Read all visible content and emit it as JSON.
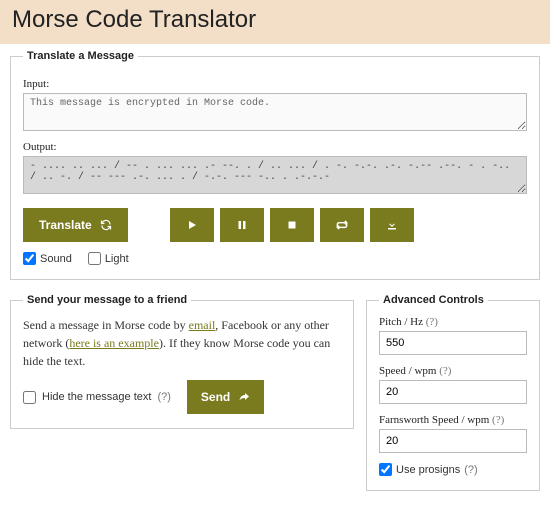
{
  "header": {
    "title": "Morse Code Translator"
  },
  "translate": {
    "legend": "Translate a Message",
    "input_label": "Input:",
    "input_value": "This message is encrypted in Morse code.",
    "output_label": "Output:",
    "output_value": "- .... .. ... / -- . ... ... .- --. . / .. ... / . -. -.-. .-. -.-- .--. - . -.. / .. -. / -- --- .-. ... . / -.-. --- -.. . .-.-.-",
    "translate_btn": "Translate",
    "sound_label": "Sound",
    "light_label": "Light",
    "sound_checked": true,
    "light_checked": false
  },
  "send": {
    "legend": "Send your message to a friend",
    "text_pre": "Send a message in Morse code by ",
    "link_email": "email",
    "text_mid1": ", Facebook or any other network (",
    "link_example": "here is an example",
    "text_mid2": "). If they know Morse code you can hide the text.",
    "hide_label": "Hide the message text",
    "hide_help": "(?)",
    "send_btn": "Send",
    "hide_checked": false
  },
  "advanced": {
    "legend": "Advanced Controls",
    "pitch_label": "Pitch / Hz",
    "pitch_help": "(?)",
    "pitch_value": "550",
    "speed_label": "Speed / wpm",
    "speed_help": "(?)",
    "speed_value": "20",
    "farns_label": "Farnsworth Speed / wpm",
    "farns_help": "(?)",
    "farns_value": "20",
    "prosigns_label": "Use prosigns",
    "prosigns_help": "(?)",
    "prosigns_checked": true
  }
}
